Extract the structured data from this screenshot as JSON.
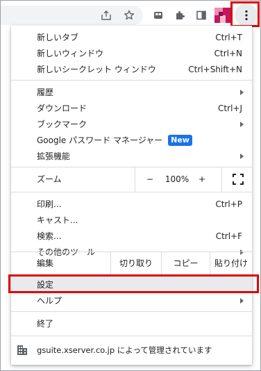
{
  "toolbar": {
    "icons": [
      "share-icon",
      "bookmark-star-icon",
      "tab-search-icon",
      "extensions-icon",
      "side-panel-icon",
      "profile-avatar",
      "more-vert-icon"
    ]
  },
  "menu": {
    "new_tab": {
      "label": "新しいタブ",
      "shortcut": "Ctrl+T"
    },
    "new_window": {
      "label": "新しいウィンドウ",
      "shortcut": "Ctrl+N"
    },
    "new_incognito": {
      "label": "新しいシークレット ウィンドウ",
      "shortcut": "Ctrl+Shift+N"
    },
    "history": {
      "label": "履歴"
    },
    "downloads": {
      "label": "ダウンロード",
      "shortcut": "Ctrl+J"
    },
    "bookmarks": {
      "label": "ブックマーク"
    },
    "password_manager": {
      "label": "Google パスワード マネージャー",
      "badge": "New"
    },
    "extensions": {
      "label": "拡張機能"
    },
    "zoom": {
      "label": "ズーム",
      "minus": "−",
      "value": "100%",
      "plus": "+"
    },
    "print": {
      "label": "印刷...",
      "shortcut": "Ctrl+P"
    },
    "cast": {
      "label": "キャスト..."
    },
    "find": {
      "label": "検索...",
      "shortcut": "Ctrl+F"
    },
    "more_tools": {
      "label": "その他のツール"
    },
    "edit": {
      "label": "編集",
      "cut": "切り取り",
      "copy": "コピー",
      "paste": "貼り付け"
    },
    "settings": {
      "label": "設定"
    },
    "help": {
      "label": "ヘルプ"
    },
    "exit": {
      "label": "終了"
    },
    "managed": {
      "text": "gsuite.xserver.co.jp によって管理されています"
    }
  },
  "colors": {
    "highlight": "#e00000",
    "badge": "#1a73e8",
    "profile_magenta": "#c2185b",
    "profile_pink": "#f48fb1"
  }
}
